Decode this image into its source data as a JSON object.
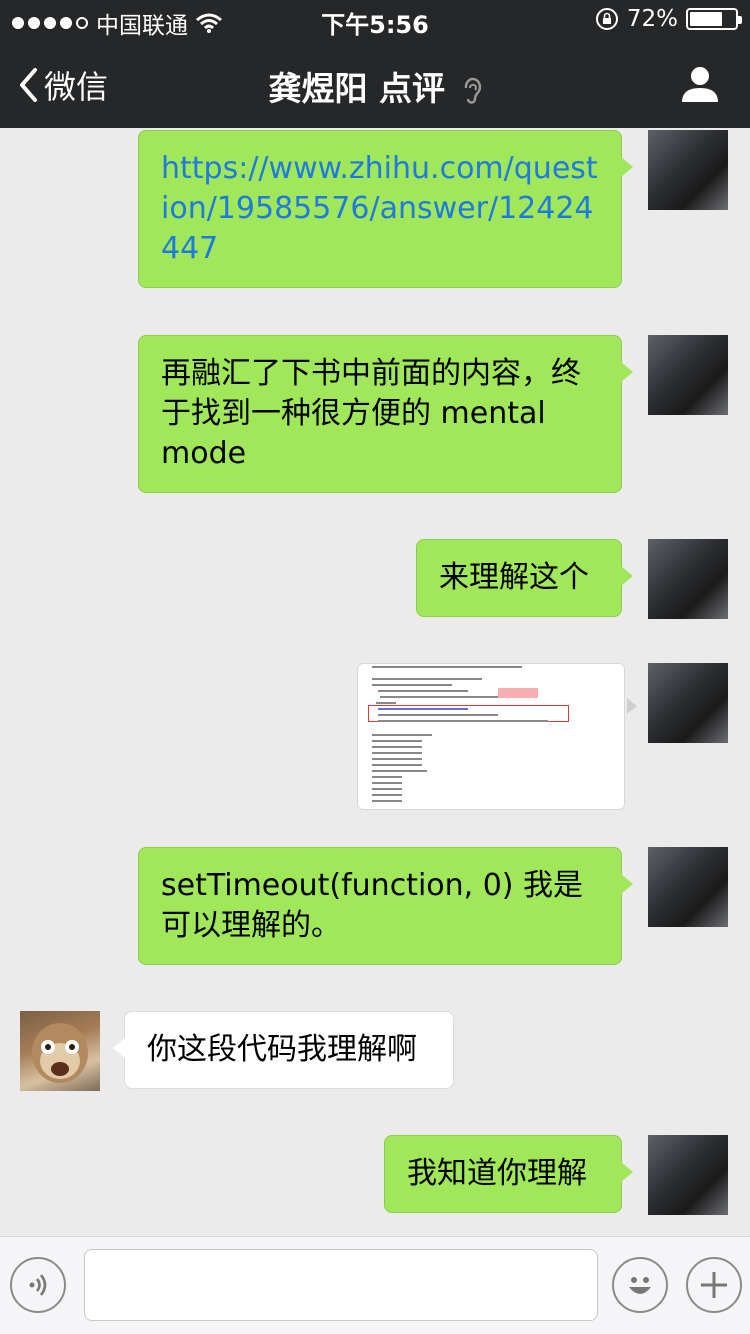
{
  "status_bar": {
    "carrier": "中国联通",
    "time": "下午5:56",
    "battery": "72%",
    "battery_level": 0.72
  },
  "nav": {
    "back_label": "微信",
    "title": "龚煜阳 点评",
    "ear_symbol": "ʕ"
  },
  "messages": [
    {
      "from": "me",
      "type": "text",
      "text": "https://www.zhihu.com/question/19585576/answer/12424447"
    },
    {
      "from": "me",
      "type": "text",
      "text": "再融汇了下书中前面的内容，终于找到一种很方便的 mental mode"
    },
    {
      "from": "me",
      "type": "text",
      "text": "来理解这个"
    },
    {
      "from": "me",
      "type": "image",
      "icon": "code-screenshot-image"
    },
    {
      "from": "me",
      "type": "text",
      "text": "setTimeout(function, 0) 我是可以理解的。"
    },
    {
      "from": "friend",
      "type": "text",
      "text": "你这段代码我理解啊"
    },
    {
      "from": "me",
      "type": "text",
      "text": "我知道你理解"
    }
  ],
  "input_bar": {
    "voice_icon": "voice-icon",
    "emoji_icon": "emoji-icon",
    "plus_icon": "plus-icon",
    "placeholder": ""
  },
  "colors": {
    "nav_bg": "#262728",
    "bubble_green": "#a0e75a",
    "link_blue": "#1f7ae0",
    "chat_bg": "#ebebeb"
  }
}
